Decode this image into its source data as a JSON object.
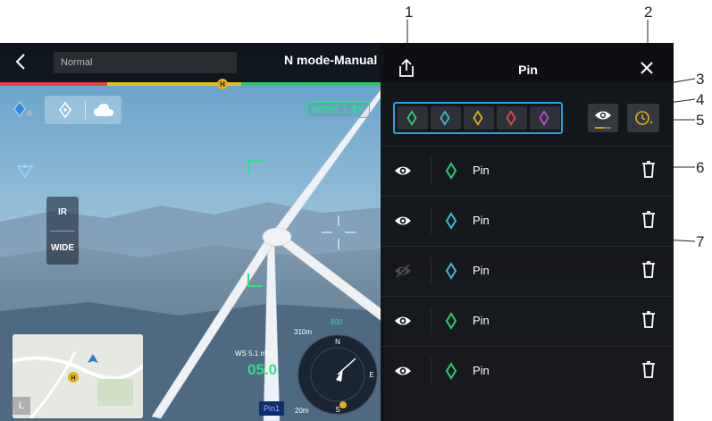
{
  "callouts": [
    "1",
    "2",
    "3",
    "4",
    "5",
    "6",
    "7"
  ],
  "topbar": {
    "mode_field": "Normal",
    "flight_mode": "N mode-Manual f"
  },
  "lens": {
    "ir_label": "IR",
    "wide_label": "WIDE"
  },
  "camera": {
    "zoom_badge": "WIDE 1.8X"
  },
  "telemetry": {
    "alt_top": "310m",
    "alt_bottom": "20m",
    "ws": "WS 5.1 m/s",
    "speed": "05.0",
    "marker_top": "800"
  },
  "pin_tag": "Pin1",
  "minimap": {
    "corner_label": "L"
  },
  "panel": {
    "title": "Pin",
    "colors": [
      "#2ecc71",
      "#3fb8d6",
      "#e0b020",
      "#e84a4a",
      "#c447e0"
    ],
    "rows": [
      {
        "label": "Pin",
        "color": "#2ecc71",
        "visible": true
      },
      {
        "label": "Pin",
        "color": "#3fb8d6",
        "visible": true
      },
      {
        "label": "Pin",
        "color": "#3fb8d6",
        "visible": false
      },
      {
        "label": "Pin",
        "color": "#2ecc71",
        "visible": true
      },
      {
        "label": "Pin",
        "color": "#2ecc71",
        "visible": true
      }
    ]
  }
}
